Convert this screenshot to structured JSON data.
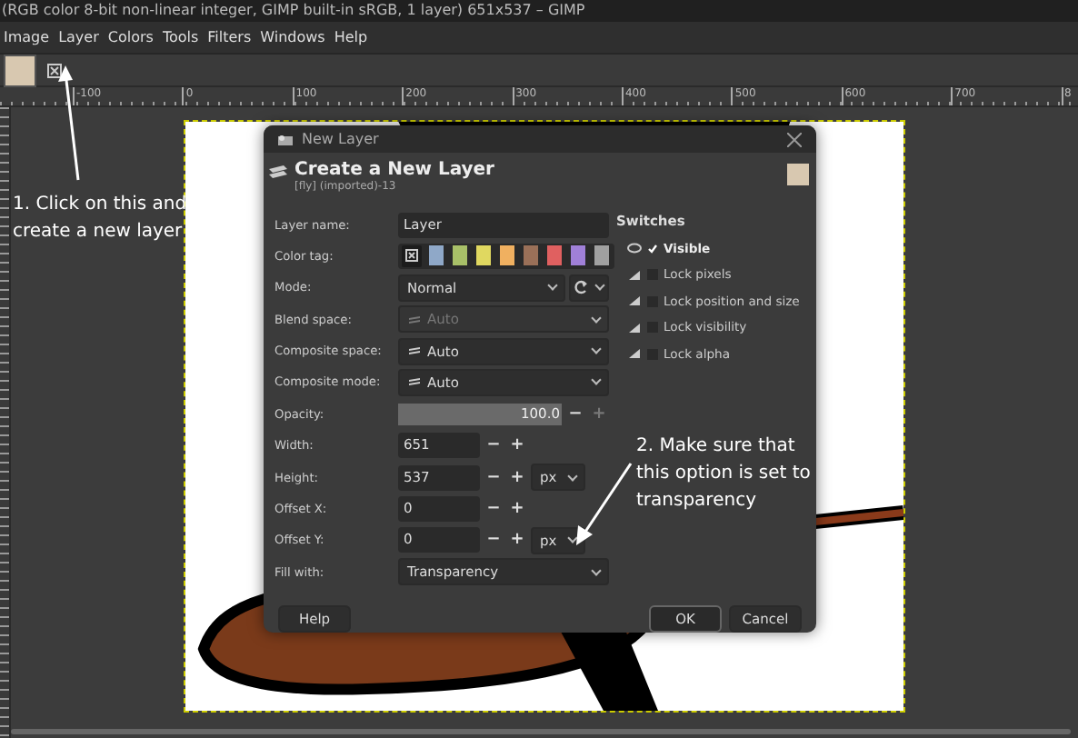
{
  "window": {
    "title": "(RGB color 8-bit non-linear integer, GIMP built-in sRGB, 1 layer) 651x537 – GIMP"
  },
  "menu": [
    {
      "label": "Image"
    },
    {
      "label": "Layer"
    },
    {
      "label": "Colors"
    },
    {
      "label": "Tools"
    },
    {
      "label": "Filters"
    },
    {
      "label": "Windows"
    },
    {
      "label": "Help"
    }
  ],
  "ruler": [
    "-100",
    "0",
    "100",
    "200",
    "300",
    "400",
    "500",
    "600",
    "700",
    "8"
  ],
  "annotations": [
    {
      "text": "1. Click on this and create a new layer"
    },
    {
      "text": "2. Make sure that this option is set to transparency"
    }
  ],
  "dialog": {
    "title": "New Layer",
    "heading": "Create a New Layer",
    "subtitle": "[fly] (imported)-13",
    "rows": [
      {
        "kind": "text",
        "label": "Layer name:",
        "value": "Layer"
      },
      {
        "kind": "tags",
        "label": "Color tag:",
        "tags": [
          {
            "kind": "none",
            "selected": true
          },
          {
            "color": "#8fa8c8",
            "selected": false
          },
          {
            "color": "#a8c068",
            "selected": false
          },
          {
            "color": "#e0d860",
            "selected": false
          },
          {
            "color": "#f0b060",
            "selected": false
          },
          {
            "color": "#9a7058",
            "selected": false
          },
          {
            "color": "#e06060",
            "selected": false
          },
          {
            "color": "#a080d8",
            "selected": false
          },
          {
            "color": "#a0a0a0",
            "selected": false
          }
        ]
      },
      {
        "kind": "mode",
        "label": "Mode:",
        "value": "Normal"
      },
      {
        "kind": "space",
        "label": "Blend space:",
        "value": "Auto",
        "disabled": true
      },
      {
        "kind": "space",
        "label": "Composite space:",
        "value": "Auto",
        "disabled": false
      },
      {
        "kind": "space",
        "label": "Composite mode:",
        "value": "Auto",
        "disabled": false
      },
      {
        "kind": "slider",
        "label": "Opacity:",
        "value": "100.0",
        "level": 1,
        "minus": "−",
        "plus": "+"
      },
      {
        "kind": "spin",
        "label": "Width:",
        "value": "651",
        "minus": "−",
        "plus": "+"
      },
      {
        "kind": "spin",
        "label": "Height:",
        "value": "537",
        "unit": "px",
        "minus": "−",
        "plus": "+"
      },
      {
        "kind": "spin",
        "label": "Offset X:",
        "value": "0",
        "minus": "−",
        "plus": "+"
      },
      {
        "kind": "spin",
        "label": "Offset Y:",
        "value": "0",
        "unit": "px",
        "minus": "−",
        "plus": "+"
      },
      {
        "kind": "combo",
        "label": "Fill with:",
        "value": "Transparency"
      }
    ],
    "switches": {
      "heading": "Switches",
      "items": [
        {
          "label": "Visible",
          "checked": true
        },
        {
          "label": "Lock pixels",
          "checked": false
        },
        {
          "label": "Lock position and size",
          "checked": false
        },
        {
          "label": "Lock visibility",
          "checked": false
        },
        {
          "label": "Lock alpha",
          "checked": false
        }
      ]
    },
    "buttons": [
      {
        "label": "Help",
        "default": false
      },
      {
        "label": "OK",
        "default": true
      },
      {
        "label": "Cancel",
        "default": false
      }
    ]
  }
}
